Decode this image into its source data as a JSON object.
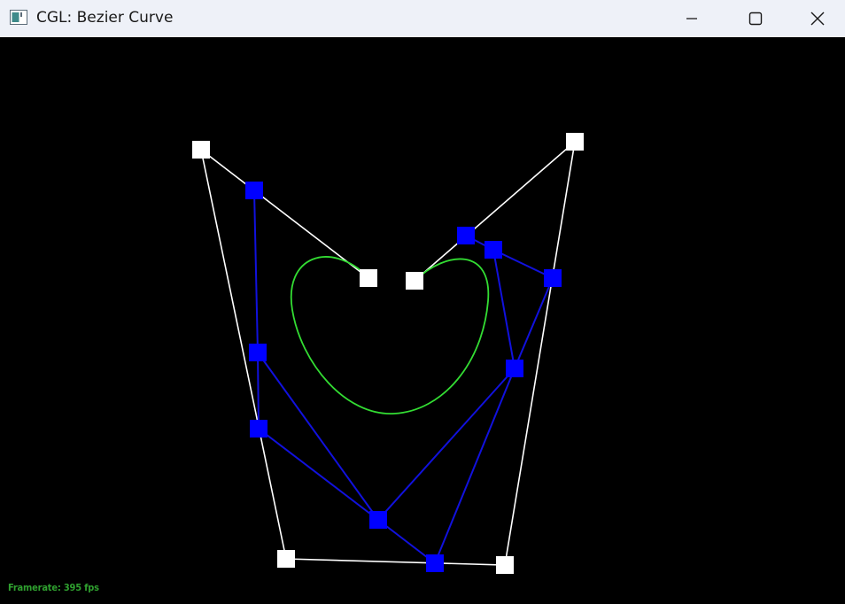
{
  "window": {
    "title": "CGL: Bezier Curve",
    "icon": "app-window-icon",
    "controls": {
      "minimize_icon": "minimize-icon",
      "maximize_icon": "maximize-icon",
      "close_icon": "close-icon"
    }
  },
  "status": {
    "framerate": "Framerate: 395 fps"
  },
  "colors": {
    "background": "#000000",
    "outer_polygon": "#ffffff",
    "intermediate": "#0000ff",
    "curve": "#33dd33",
    "framerate_text": "#2fa02f"
  }
}
